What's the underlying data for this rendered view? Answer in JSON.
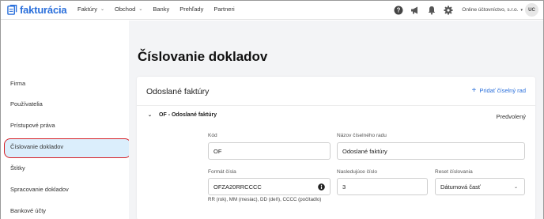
{
  "app": {
    "logo_text": "fakturácia"
  },
  "nav": {
    "items": [
      {
        "label": "Faktúry",
        "has_dropdown": true
      },
      {
        "label": "Obchod",
        "has_dropdown": true
      },
      {
        "label": "Banky",
        "has_dropdown": false
      },
      {
        "label": "Prehľady",
        "has_dropdown": false
      },
      {
        "label": "Partneri",
        "has_dropdown": false
      }
    ],
    "company": "Online účtovníctvo, s.r.o.",
    "avatar_initials": "UC",
    "icons": [
      "help-icon",
      "megaphone-icon",
      "bell-icon",
      "gear-icon"
    ]
  },
  "sidebar": {
    "items": [
      {
        "label": "Firma"
      },
      {
        "label": "Používatelia"
      },
      {
        "label": "Prístupové práva"
      },
      {
        "label": "Číslovanie dokladov",
        "active": true
      },
      {
        "label": "Štítky"
      },
      {
        "label": "Spracovanie dokladov"
      },
      {
        "label": "Bankové účty"
      }
    ]
  },
  "main": {
    "title": "Číslovanie dokladov",
    "card": {
      "title": "Odoslané faktúry",
      "add_label": "Pridať číselný rad",
      "section": {
        "title": "OF - Odoslané faktúry",
        "badge": "Predvolený",
        "fields": {
          "code_label": "Kód",
          "code_value": "OF",
          "series_name_label": "Názov číselného radu",
          "series_name_value": "Odoslané faktúry",
          "format_label": "Formát čísla",
          "format_value": "OFZA20RRCCCC",
          "format_help": "RR (rok), MM (mesiac), DD (deň), CCCC (počítadlo)",
          "next_number_label": "Nasledujúce číslo",
          "next_number_value": "3",
          "reset_label": "Reset číslovania",
          "reset_value": "Dátumová časť"
        }
      }
    }
  },
  "colors": {
    "accent": "#2a6fdb",
    "active_bg": "#dbeefc",
    "highlight_border": "#d61f26"
  }
}
